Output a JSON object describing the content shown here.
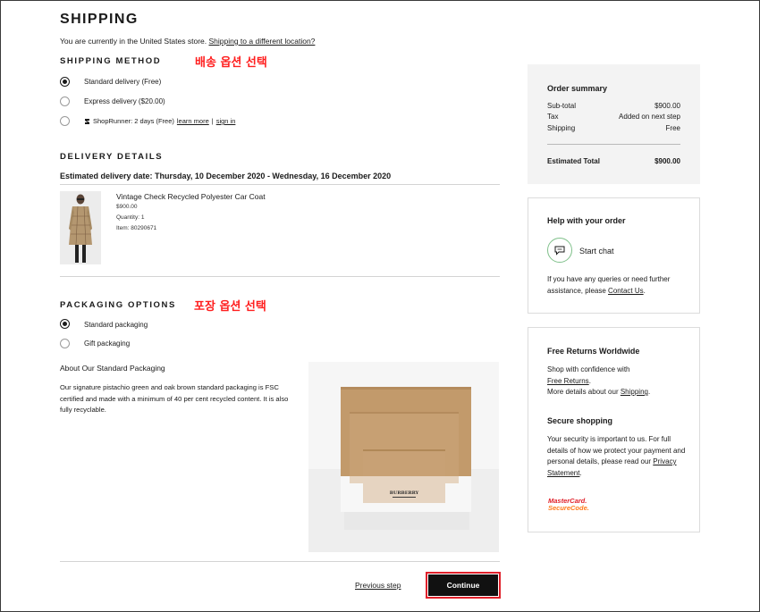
{
  "page": {
    "title": "SHIPPING",
    "store_text": "You are currently in the United States store. ",
    "store_link": "Shipping to a different location?"
  },
  "annotations": {
    "shipping_note": "배송 옵션 선택",
    "packaging_note": "포장 옵션 선택"
  },
  "shipping_method": {
    "heading": "SHIPPING METHOD",
    "options": [
      {
        "label": "Standard delivery (Free)",
        "selected": true
      },
      {
        "label": "Express delivery ($20.00)",
        "selected": false
      },
      {
        "label": "ShopRunner: 2 days (Free)",
        "selected": false
      }
    ],
    "shoprunner_learn": "learn more",
    "shoprunner_sep": "|",
    "shoprunner_signin": "sign in"
  },
  "delivery": {
    "heading": "DELIVERY DETAILS",
    "estimate": "Estimated delivery date: Thursday, 10 December 2020 - Wednesday, 16 December 2020",
    "item": {
      "name": "Vintage Check Recycled Polyester Car Coat",
      "price": "$900.00",
      "quantity": "Quantity: 1",
      "item_no": "Item: 80290671"
    }
  },
  "packaging": {
    "heading": "PACKAGING OPTIONS",
    "options": [
      {
        "label": "Standard packaging",
        "selected": true
      },
      {
        "label": "Gift packaging",
        "selected": false
      }
    ],
    "about_title": "About Our Standard Packaging",
    "about_text": "Our signature pistachio green and oak brown standard packaging is FSC certified and made with a minimum of 40 per cent recycled content. It is also fully recyclable.",
    "brand": "BURBERRY"
  },
  "footer": {
    "previous": "Previous step",
    "continue": "Continue"
  },
  "order_summary": {
    "title": "Order summary",
    "rows": [
      {
        "label": "Sub-total",
        "value": "$900.00"
      },
      {
        "label": "Tax",
        "value": "Added on next step"
      },
      {
        "label": "Shipping",
        "value": "Free"
      }
    ],
    "total_label": "Estimated Total",
    "total_value": "$900.00"
  },
  "help": {
    "title": "Help with your order",
    "chat": "Start chat",
    "text": "If you have any queries or need further assistance, please ",
    "contact": "Contact Us",
    "period": "."
  },
  "returns": {
    "title": "Free Returns Worldwide",
    "line1": "Shop with confidence with",
    "free_returns": "Free Returns",
    "line2_pre": ".",
    "line3": "More details about our ",
    "shipping_link": "Shipping",
    "line3_end": ".",
    "secure_title": "Secure shopping",
    "secure_text": "Your security is important to us. For full details of how we protect your payment and personal details, please read our ",
    "privacy": "Privacy Statement",
    "secure_end": ".",
    "mc_line1": "MasterCard.",
    "mc_line2": "SecureCode."
  },
  "colors": {
    "accent_red": "#e0202a",
    "summary_bg": "#f3f3f3",
    "chat_green": "#7fc08a",
    "box_brown": "#c29a6b"
  }
}
